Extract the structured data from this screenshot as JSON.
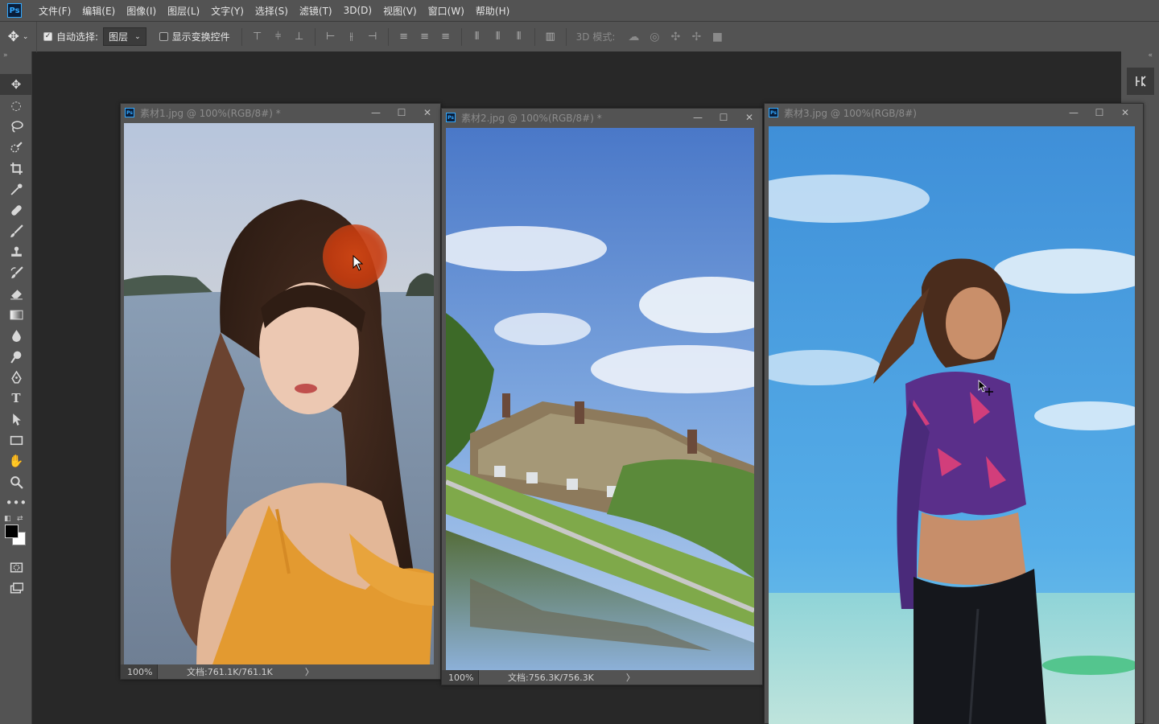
{
  "app": {
    "logo": "Ps"
  },
  "menu": [
    "文件(F)",
    "编辑(E)",
    "图像(I)",
    "图层(L)",
    "文字(Y)",
    "选择(S)",
    "滤镜(T)",
    "3D(D)",
    "视图(V)",
    "窗口(W)",
    "帮助(H)"
  ],
  "options": {
    "auto_select_label": "自动选择:",
    "auto_select_checked": true,
    "layer_select_value": "图层",
    "show_transform_label": "显示变换控件",
    "show_transform_checked": false,
    "mode3d_label": "3D 模式:"
  },
  "documents": [
    {
      "title": "素材1.jpg @ 100%(RGB/8#) *",
      "zoom": "100%",
      "doc_size": "文档:761.1K/761.1K"
    },
    {
      "title": "素材2.jpg @ 100%(RGB/8#) *",
      "zoom": "100%",
      "doc_size": "文档:756.3K/756.3K"
    },
    {
      "title": "素材3.jpg @ 100%(RGB/8#)",
      "zoom": "",
      "doc_size": ""
    }
  ],
  "colors": {
    "accent": "#31a8ff",
    "foreground": "#000000",
    "background": "#ffffff"
  }
}
